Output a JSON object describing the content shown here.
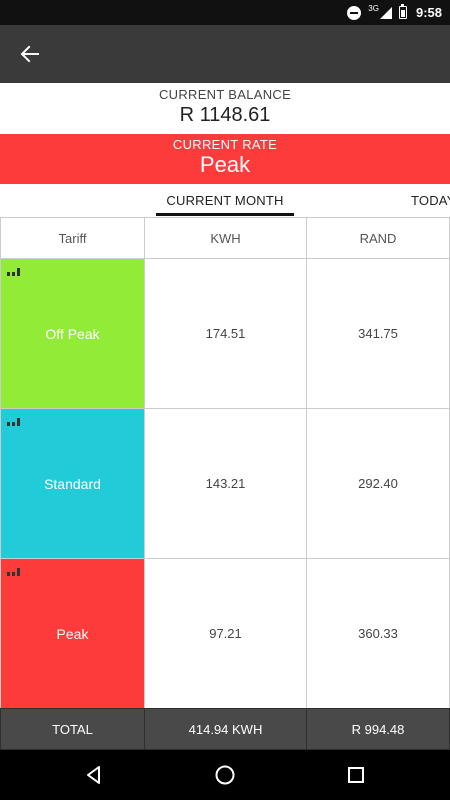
{
  "status_bar": {
    "network": "3G",
    "time": "9:58"
  },
  "balance": {
    "label": "CURRENT BALANCE",
    "value": "R 1148.61"
  },
  "rate": {
    "label": "CURRENT RATE",
    "value": "Peak",
    "color": "#fd3b3b"
  },
  "tabs": [
    {
      "label": "CURRENT MONTH",
      "selected": true
    },
    {
      "label": "TODAY",
      "selected": false
    }
  ],
  "table": {
    "headers": [
      "Tariff",
      "KWH",
      "RAND"
    ],
    "rows": [
      {
        "tariff": "Off Peak",
        "kwh": "174.51",
        "rand": "341.75",
        "color": "#92ec37"
      },
      {
        "tariff": "Standard",
        "kwh": "143.21",
        "rand": "292.40",
        "color": "#22cbd8"
      },
      {
        "tariff": "Peak",
        "kwh": "97.21",
        "rand": "360.33",
        "color": "#fd3b3b"
      }
    ],
    "total": {
      "label": "TOTAL",
      "kwh": "414.94 KWH",
      "rand": "R 994.48"
    }
  },
  "icons": {
    "back": "arrow-left-icon",
    "row_chart": "bar-chart-icon",
    "nav_back": "triangle-back-icon",
    "nav_home": "circle-home-icon",
    "nav_recents": "square-recents-icon"
  }
}
